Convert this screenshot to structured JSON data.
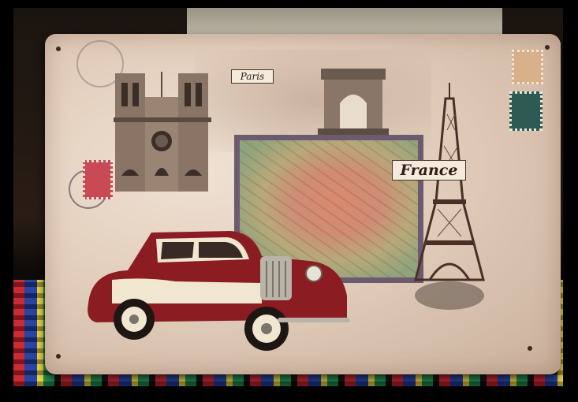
{
  "sign": {
    "paris_label": "Paris",
    "france_label": "France"
  },
  "colors": {
    "sign_base": "#e2cdbb",
    "car_body": "#8b1d22",
    "car_cream": "#f1e6cf",
    "map_frame": "#6b5a70"
  }
}
